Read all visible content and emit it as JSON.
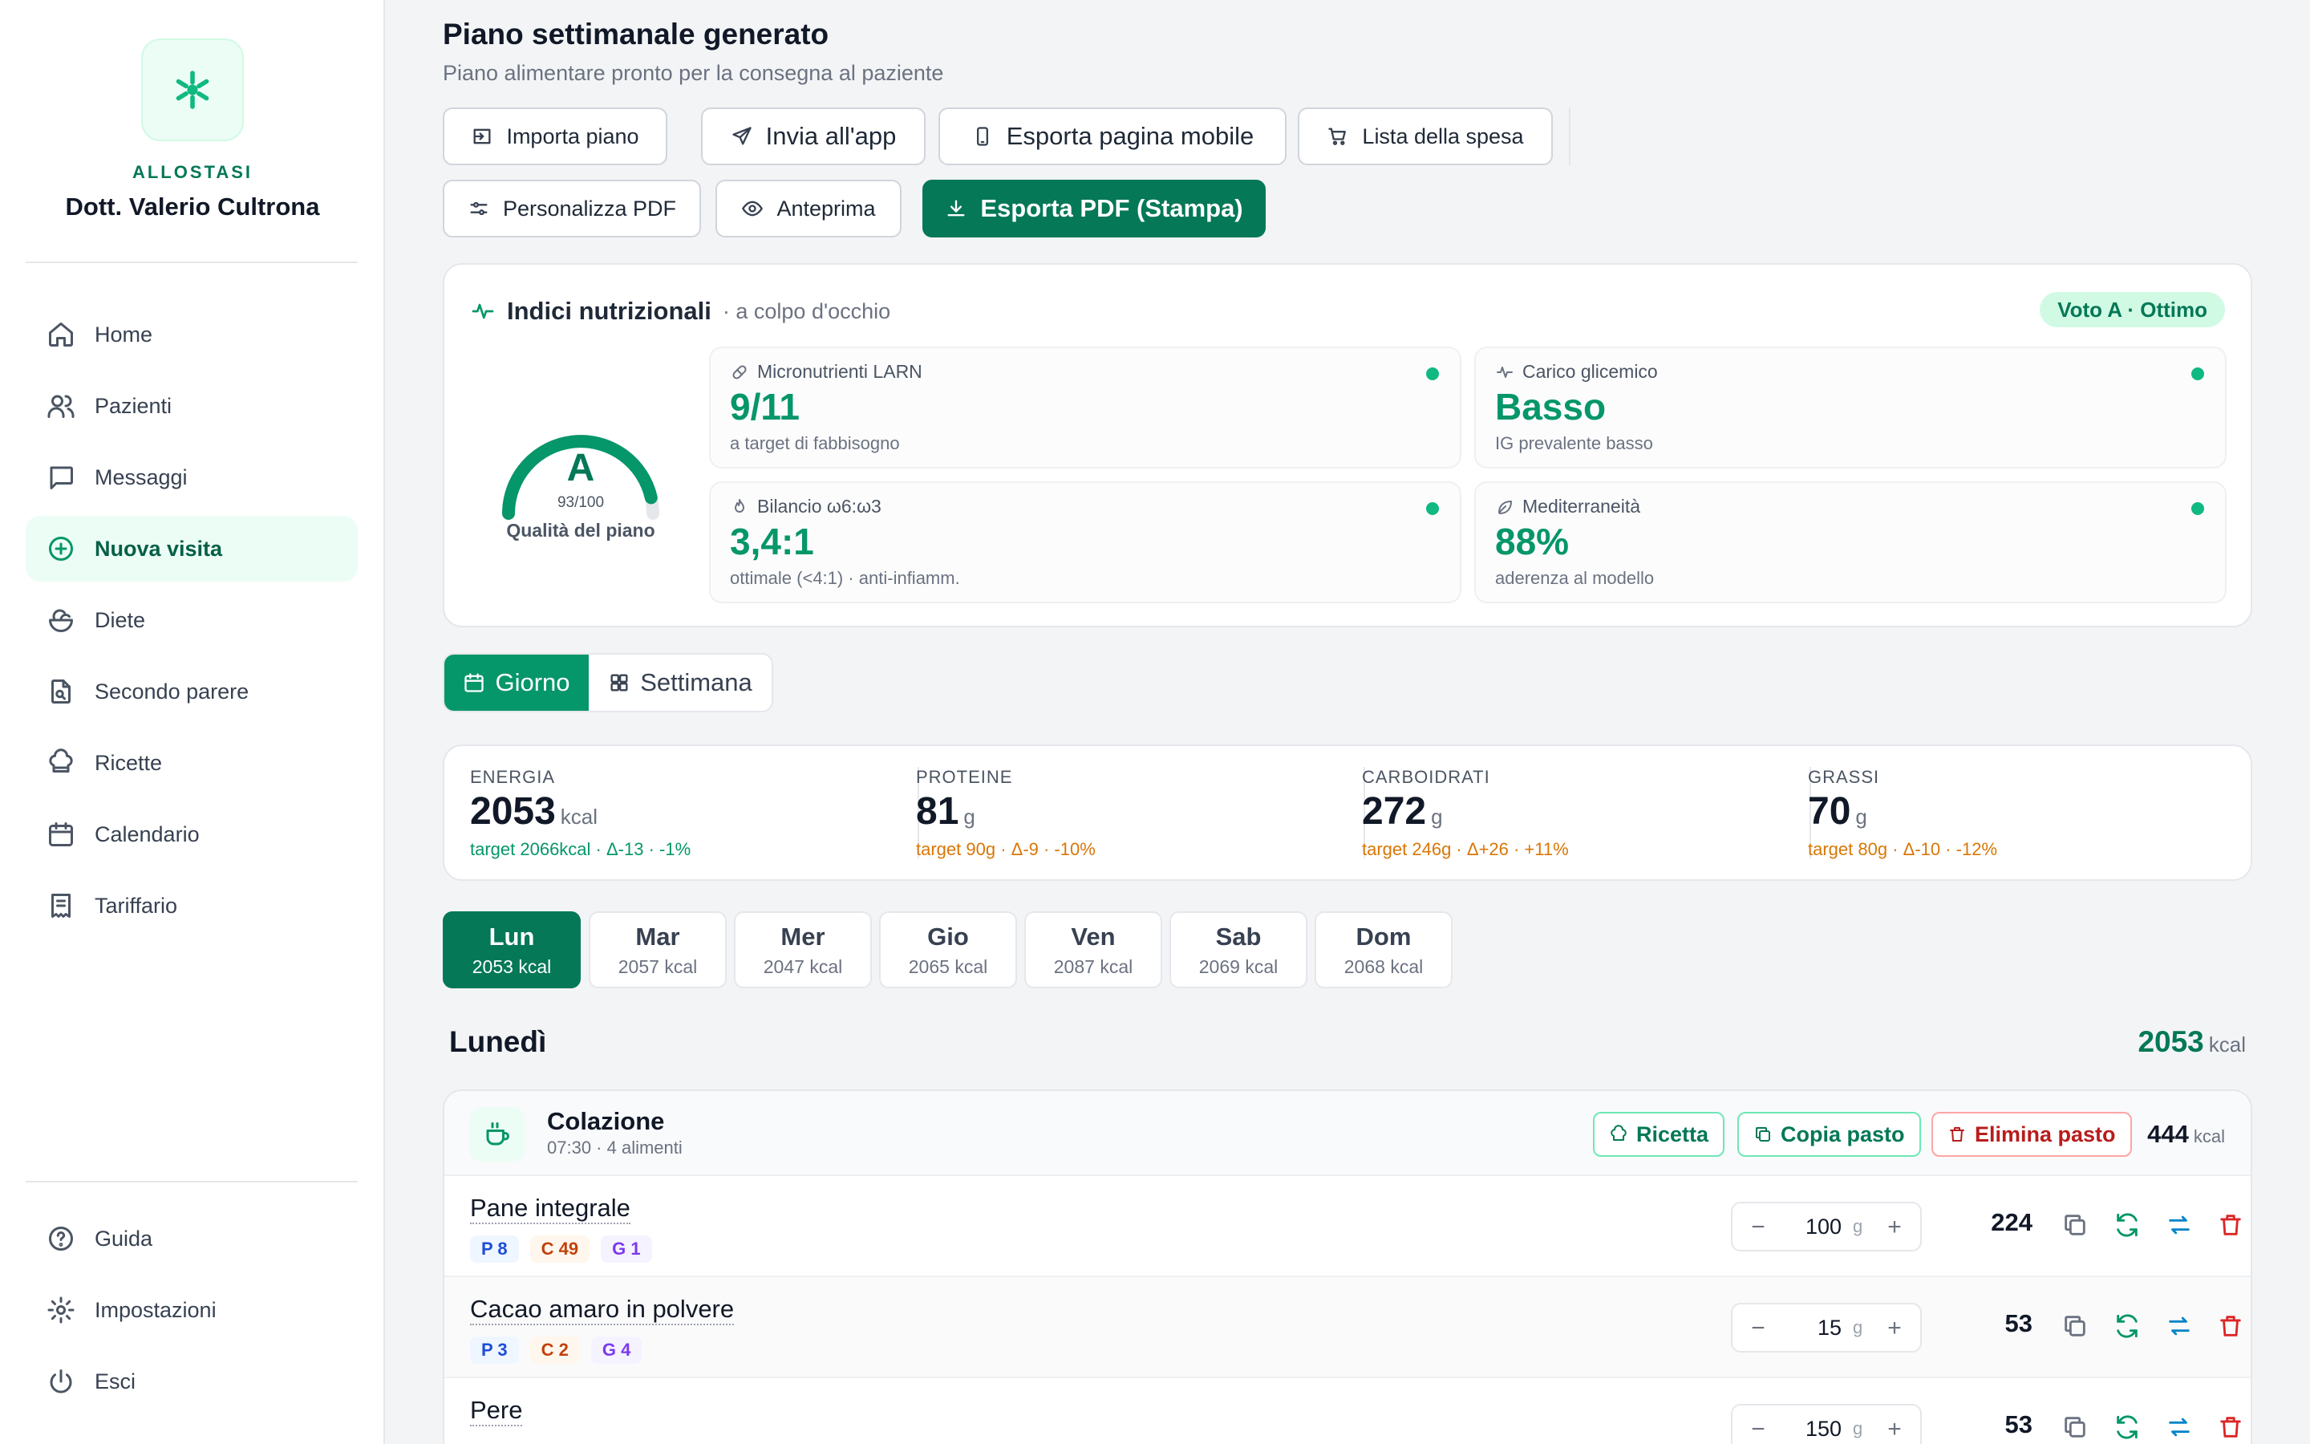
{
  "sidebar": {
    "brand": "ALLOSTASI",
    "doctor": "Dott. Valerio Cultrona",
    "items": [
      {
        "label": "Home",
        "icon": "home-icon"
      },
      {
        "label": "Pazienti",
        "icon": "users-icon"
      },
      {
        "label": "Messaggi",
        "icon": "message-icon"
      },
      {
        "label": "Nuova visita",
        "icon": "plus-circle-icon",
        "active": true
      },
      {
        "label": "Diete",
        "icon": "salad-icon"
      },
      {
        "label": "Secondo parere",
        "icon": "file-search-icon"
      },
      {
        "label": "Ricette",
        "icon": "chef-hat-icon"
      },
      {
        "label": "Calendario",
        "icon": "calendar-icon"
      },
      {
        "label": "Tariffario",
        "icon": "receipt-icon"
      }
    ],
    "footer": [
      {
        "label": "Guida",
        "icon": "help-icon"
      },
      {
        "label": "Impostazioni",
        "icon": "gear-icon"
      },
      {
        "label": "Esci",
        "icon": "power-icon"
      }
    ]
  },
  "header": {
    "title": "Piano settimanale generato",
    "subtitle": "Piano alimentare pronto per la consegna al paziente"
  },
  "toolbar": {
    "import": "Importa piano",
    "send_app": "Invia all'app",
    "export_mobile": "Esporta pagina mobile",
    "shopping": "Lista della spesa",
    "customize_pdf": "Personalizza PDF",
    "preview": "Anteprima",
    "export_pdf": "Esporta PDF (Stampa)"
  },
  "indices": {
    "title": "Indici nutrizionali",
    "subtitle": "· a colpo d'occhio",
    "grade_badge": "Voto A · Ottimo",
    "gauge": {
      "letter": "A",
      "score_text": "93/100",
      "score": 93,
      "max": 100,
      "label": "Qualità del piano"
    },
    "metrics": [
      {
        "label": "Micronutrienti LARN",
        "icon": "pill-icon",
        "value": "9/11",
        "desc": "a target di fabbisogno"
      },
      {
        "label": "Carico glicemico",
        "icon": "activity-icon",
        "value": "Basso",
        "desc": "IG prevalente basso"
      },
      {
        "label": "Bilancio ω6:ω3",
        "icon": "flame-icon",
        "value": "3,4:1",
        "desc": "ottimale (<4:1) · anti-infiamm."
      },
      {
        "label": "Mediterraneità",
        "icon": "leaf-icon",
        "value": "88%",
        "desc": "aderenza al modello"
      }
    ]
  },
  "view_toggle": {
    "day": "Giorno",
    "week": "Settimana"
  },
  "macros": [
    {
      "key": "ENERGIA",
      "value": "2053",
      "unit": "kcal",
      "target": "target 2066kcal · Δ-13 · -1%",
      "tone": "green"
    },
    {
      "key": "PROTEINE",
      "value": "81",
      "unit": "g",
      "target": "target 90g · Δ-9 · -10%",
      "tone": "amber"
    },
    {
      "key": "CARBOIDRATI",
      "value": "272",
      "unit": "g",
      "target": "target 246g · Δ+26 · +11%",
      "tone": "amber"
    },
    {
      "key": "GRASSI",
      "value": "70",
      "unit": "g",
      "target": "target 80g · Δ-10 · -12%",
      "tone": "amber"
    }
  ],
  "days": [
    {
      "name": "Lun",
      "kcal": "2053 kcal",
      "active": true
    },
    {
      "name": "Mar",
      "kcal": "2057 kcal"
    },
    {
      "name": "Mer",
      "kcal": "2047 kcal"
    },
    {
      "name": "Gio",
      "kcal": "2065 kcal"
    },
    {
      "name": "Ven",
      "kcal": "2087 kcal"
    },
    {
      "name": "Sab",
      "kcal": "2069 kcal"
    },
    {
      "name": "Dom",
      "kcal": "2068 kcal"
    }
  ],
  "day_view": {
    "title": "Lunedì",
    "total": "2053",
    "unit": "kcal"
  },
  "meal": {
    "name": "Colazione",
    "meta": "07:30 · 4 alimenti",
    "recipe": "Ricetta",
    "copy": "Copia pasto",
    "delete": "Elimina pasto",
    "kcal": "444",
    "unit": "kcal",
    "foods": [
      {
        "name": "Pane integrale",
        "p": "P 8",
        "c": "C 49",
        "g": "G 1",
        "qty": "100",
        "unit": "g",
        "kcal": "224"
      },
      {
        "name": "Cacao amaro in polvere",
        "p": "P 3",
        "c": "C 2",
        "g": "G 4",
        "qty": "15",
        "unit": "g",
        "kcal": "53"
      },
      {
        "name": "Pere",
        "p": "",
        "c": "",
        "g": "",
        "qty": "150",
        "unit": "g",
        "kcal": "53"
      }
    ]
  },
  "colors": {
    "accent": "#047857",
    "accent_light": "#ecfdf5",
    "amber": "#d97706",
    "red": "#b91c1c"
  }
}
